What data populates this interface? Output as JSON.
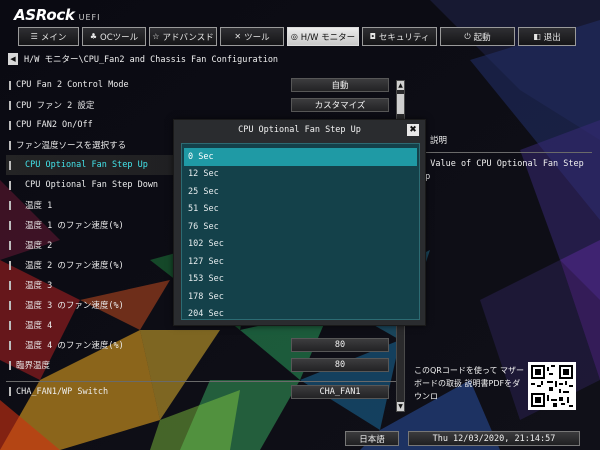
{
  "header": {
    "brand": "ASRock",
    "product": "UEFI"
  },
  "tabs": [
    {
      "icon": "☰",
      "label": "メイン",
      "name": "main"
    },
    {
      "icon": "♣",
      "label": "OCツール",
      "name": "oc-tweaker"
    },
    {
      "icon": "☆",
      "label": "アドバンスド",
      "name": "advanced"
    },
    {
      "icon": "✕",
      "label": "ツール",
      "name": "tool"
    },
    {
      "icon": "◎",
      "label": "H/W モニター",
      "name": "hw-monitor",
      "active": true
    },
    {
      "icon": "◘",
      "label": "セキュリティ",
      "name": "security"
    },
    {
      "icon": "⏻",
      "label": "起動",
      "name": "boot"
    },
    {
      "icon": "◧",
      "label": "退出",
      "name": "exit"
    }
  ],
  "breadcrumb": {
    "back_icon": "◀",
    "path": "H/W モニター\\CPU_Fan2 and Chassis Fan Configuration"
  },
  "settings": [
    {
      "label": "CPU Fan 2 Control Mode",
      "value": "自動"
    },
    {
      "label": "CPU ファン 2 設定",
      "value": "カスタマイズ"
    },
    {
      "label": "CPU FAN2 On/Off",
      "value": ""
    },
    {
      "label": "ファン温度ソースを選択する",
      "value": ""
    },
    {
      "label": "CPU Optional Fan Step Up",
      "value": "",
      "indent": true,
      "highlight": true
    },
    {
      "label": "CPU Optional Fan Step Down",
      "value": "",
      "indent": true
    },
    {
      "label": "温度 1",
      "value": "",
      "indent": true
    },
    {
      "label": "温度 1 のファン速度(%)",
      "value": "",
      "indent": true
    },
    {
      "label": "温度 2",
      "value": "",
      "indent": true
    },
    {
      "label": "温度 2 のファン速度(%)",
      "value": "",
      "indent": true
    },
    {
      "label": "温度 3",
      "value": "",
      "indent": true
    },
    {
      "label": "温度 3 のファン速度(%)",
      "value": "",
      "indent": true
    },
    {
      "label": "温度 4",
      "value": "",
      "indent": true
    },
    {
      "label": "温度 4 のファン速度(%)",
      "value": "80",
      "indent": true
    },
    {
      "label": "臨界温度",
      "value": "80",
      "indent": false
    },
    {
      "label": "CHA_FAN1/WP Switch",
      "value": "CHA_FAN1",
      "sep": true
    }
  ],
  "popup": {
    "title": "CPU Optional Fan Step Up",
    "close_icon": "✖",
    "options": [
      "0 Sec",
      "12 Sec",
      "25 Sec",
      "51 Sec",
      "76 Sec",
      "102 Sec",
      "127 Sec",
      "153 Sec",
      "178 Sec",
      "204 Sec"
    ],
    "selected_index": 0
  },
  "description": {
    "heading": "説明",
    "text": "e Value of CPU Optional Fan Step Up"
  },
  "qr": {
    "caption": "このQRコードを使って マザーボードの取扱 説明書PDFをダウンロ"
  },
  "status": {
    "language": "日本語",
    "datetime": "Thu 12/03/2020, 21:14:57"
  },
  "colors": {
    "accent": "#43e3ea",
    "popup_list_bg": "#14414a",
    "popup_selected": "#1f9aa5",
    "tab_active_bg": "#dcdcdc"
  }
}
